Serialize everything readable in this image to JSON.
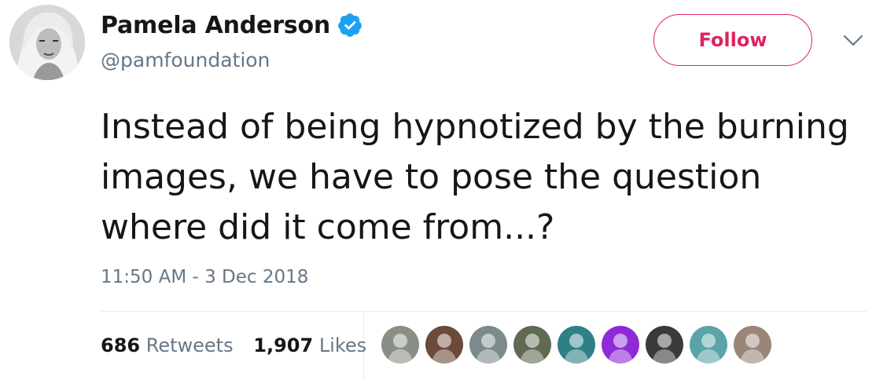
{
  "tweet": {
    "author": {
      "display_name": "Pamela Anderson",
      "handle": "@pamfoundation",
      "verified": true,
      "avatar_icon": "profile-photo"
    },
    "follow_label": "Follow",
    "menu_icon": "chevron-down-icon",
    "text": "Instead of being hypnotized by the burning images, we have to pose the question where did it come from...?",
    "timestamp": "11:50 AM - 3 Dec 2018",
    "stats": {
      "retweets_count": "686",
      "retweets_label": "Retweets",
      "likes_count": "1,907",
      "likes_label": "Likes"
    },
    "likers": [
      {
        "icon": "user-avatar",
        "color": "#8a8f86"
      },
      {
        "icon": "user-avatar",
        "color": "#6b4a3a"
      },
      {
        "icon": "user-avatar",
        "color": "#7d8a8c"
      },
      {
        "icon": "user-avatar",
        "color": "#5e6a52"
      },
      {
        "icon": "user-avatar",
        "color": "#2f7f86"
      },
      {
        "icon": "user-avatar",
        "color": "#8e2bd6"
      },
      {
        "icon": "user-avatar",
        "color": "#3a3a3a"
      },
      {
        "icon": "user-avatar",
        "color": "#5aa3a8"
      },
      {
        "icon": "user-avatar",
        "color": "#9a8578"
      }
    ],
    "colors": {
      "accent": "#e0245e",
      "verified": "#1da1f2",
      "secondary_text": "#657786",
      "divider": "#e6ecf0"
    }
  }
}
